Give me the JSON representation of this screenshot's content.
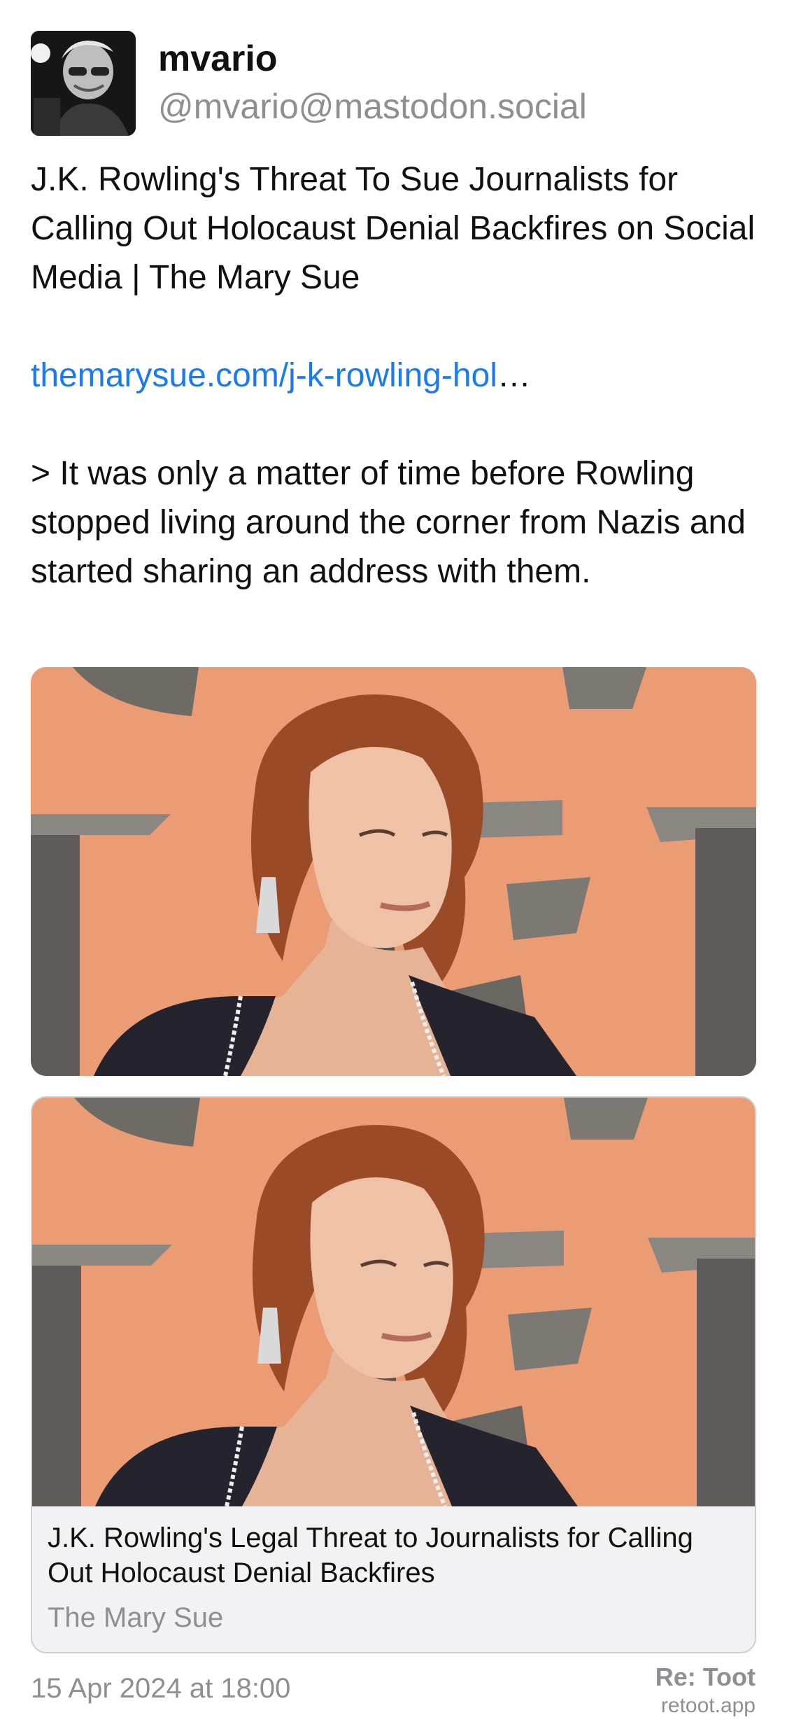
{
  "author": {
    "display_name": "mvario",
    "handle": "@mvario@mastodon.social"
  },
  "post": {
    "paragraph_1": "J.K. Rowling's Threat To Sue Journalists for Calling Out Holocaust Denial Backfires on Social Media | The Mary Sue",
    "link_text": "themarysue.com/j-k-rowling-hol",
    "link_ellipsis": "…",
    "quote": "> It was only a matter of time before Rowling stopped living around the corner from Nazis and started sharing an address with them."
  },
  "link_card": {
    "title": "J.K. Rowling's Legal Threat to Journalists for Calling Out Holocaust Denial Backfires",
    "source": "The Mary Sue"
  },
  "footer": {
    "timestamp": "15 Apr 2024 at 18:00",
    "brand_title": "Re: Toot",
    "brand_url": "retoot.app"
  },
  "colors": {
    "link": "#1a7bf0",
    "secondary_text": "#8e8e93",
    "card_background": "#f2f2f4",
    "photo_background": "#ec9c74"
  }
}
